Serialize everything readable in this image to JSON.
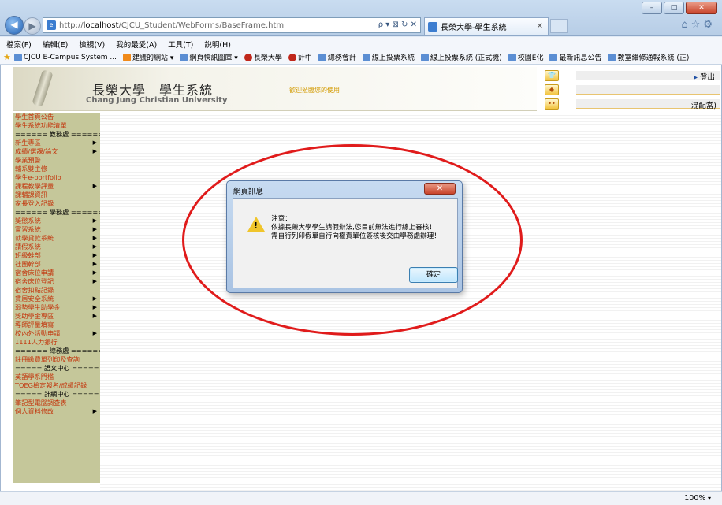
{
  "browser": {
    "address_prefix": "http://",
    "address_host": "localhost",
    "address_path": "/CJCU_Student/WebForms/BaseFrame.htm",
    "address_controls": "ρ ▾ ⊠ ↻ ✕",
    "tab_title": "長榮大學-學生系統",
    "tab_close": "✕",
    "menu": [
      "檔案(F)",
      "編輯(E)",
      "檢視(V)",
      "我的最愛(A)",
      "工具(T)",
      "說明(H)"
    ],
    "favorites": [
      {
        "label": "CJCU E-Campus System ...",
        "icon": "ie-page-icon"
      },
      {
        "label": "建議的網站 ▾",
        "icon": "suggested-sites-icon"
      },
      {
        "label": "網頁快訊圖庫 ▾",
        "icon": "ie-page-icon"
      },
      {
        "label": "長榮大學",
        "icon": "red-circle-icon"
      },
      {
        "label": "計中",
        "icon": "red-circle-icon"
      },
      {
        "label": "總務會計",
        "icon": "ie-page-icon"
      },
      {
        "label": "線上投票系統",
        "icon": "ie-page-icon"
      },
      {
        "label": "線上投票系統 (正式機)",
        "icon": "ie-page-icon"
      },
      {
        "label": "校園E化",
        "icon": "ie-page-icon"
      },
      {
        "label": "最新訊息公告",
        "icon": "ie-page-icon"
      },
      {
        "label": "教室維修通報系統 (正)",
        "icon": "ie-page-icon"
      }
    ]
  },
  "header": {
    "uni_name_zh": "長榮大學　學生系統",
    "uni_name_en": "Chang Jung Christian University",
    "welcome": "歡迎蒞臨您的使用",
    "logout": "登出",
    "role_suffix": "混配當)"
  },
  "sidebar": [
    {
      "label": "學生首頁公告",
      "arrow": false,
      "section": false
    },
    {
      "label": "學生系統功能清單",
      "arrow": false,
      "section": false
    },
    {
      "label": "====== 教務處 ======",
      "arrow": false,
      "section": true
    },
    {
      "label": "新生專區",
      "arrow": true,
      "section": false
    },
    {
      "label": "成績/選課/論文",
      "arrow": true,
      "section": false
    },
    {
      "label": "學業預警",
      "arrow": false,
      "section": false
    },
    {
      "label": "輔系雙主修",
      "arrow": false,
      "section": false
    },
    {
      "label": "學生e-portfolio",
      "arrow": false,
      "section": false
    },
    {
      "label": "課程教學評量",
      "arrow": true,
      "section": false
    },
    {
      "label": "課輔課資訊",
      "arrow": false,
      "section": false
    },
    {
      "label": "家長登入記錄",
      "arrow": false,
      "section": false
    },
    {
      "label": "====== 學務處 ======",
      "arrow": false,
      "section": true
    },
    {
      "label": "獎懲系統",
      "arrow": true,
      "section": false
    },
    {
      "label": "實習系統",
      "arrow": true,
      "section": false
    },
    {
      "label": "就學貸款系統",
      "arrow": true,
      "section": false
    },
    {
      "label": "請假系統",
      "arrow": true,
      "section": false
    },
    {
      "label": "班級幹部",
      "arrow": true,
      "section": false
    },
    {
      "label": "社團幹部",
      "arrow": true,
      "section": false
    },
    {
      "label": "宿舍床位申請",
      "arrow": true,
      "section": false
    },
    {
      "label": "宿舍床位登記",
      "arrow": true,
      "section": false
    },
    {
      "label": "宿舍扣點記錄",
      "arrow": false,
      "section": false
    },
    {
      "label": "賃居安全系統",
      "arrow": true,
      "section": false
    },
    {
      "label": "弱勢學生助學金",
      "arrow": true,
      "section": false
    },
    {
      "label": "獎助學金專區",
      "arrow": true,
      "section": false
    },
    {
      "label": "導師評量填寫",
      "arrow": false,
      "section": false
    },
    {
      "label": "校內外活動申請",
      "arrow": true,
      "section": false
    },
    {
      "label": "1111人力銀行",
      "arrow": false,
      "section": false
    },
    {
      "label": "====== 總務處 ======",
      "arrow": false,
      "section": true
    },
    {
      "label": "註冊繳費單列印及查詢",
      "arrow": false,
      "section": false
    },
    {
      "label": "===== 語文中心 =====",
      "arrow": false,
      "section": true
    },
    {
      "label": "英語學系門檻",
      "arrow": false,
      "section": false
    },
    {
      "label": "TOEG檢定報名/成績記錄",
      "arrow": false,
      "section": false
    },
    {
      "label": "===== 計網中心 =====",
      "arrow": false,
      "section": true
    },
    {
      "label": "筆記型電腦調查表",
      "arrow": false,
      "section": false
    },
    {
      "label": "個人資料修改",
      "arrow": true,
      "section": false
    }
  ],
  "dialog": {
    "title": "網頁訊息",
    "close": "✕",
    "line1": "注意：",
    "line2": "依據長榮大學學生請假辦法,您目前無法進行線上審核！",
    "line3": "需自行列印假單自行向權責單位簽核後交由學務處辦理！",
    "ok_label": "確定"
  },
  "status": {
    "zoom": "100%"
  },
  "colors": {
    "sidebar_bg": "#c5c79a",
    "sidebar_link": "#c3360d",
    "annotation": "#e01b1b"
  }
}
